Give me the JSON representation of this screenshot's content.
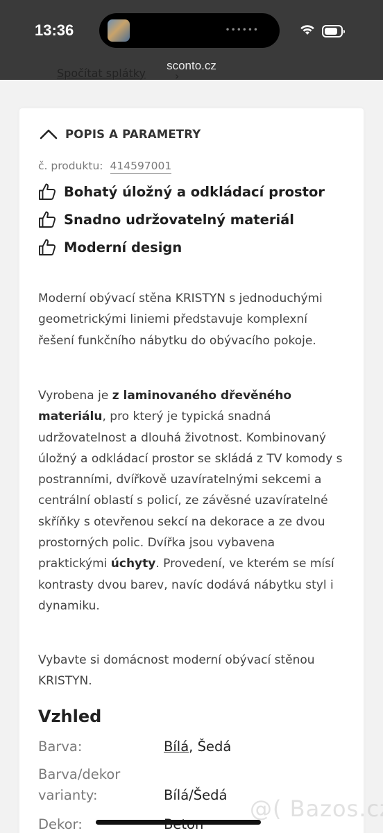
{
  "status_bar": {
    "time": "13:36",
    "url": "sconto.cz",
    "battery_level": 0.8,
    "dots": "••••••"
  },
  "cut_link": {
    "text": "Spočítat splátky",
    "chevron": "›"
  },
  "section": {
    "title": "POPIS A PARAMETRY",
    "product_label": "č. produktu:",
    "product_number": "414597001"
  },
  "features": [
    {
      "icon": "thumbs-up-icon",
      "text": "Bohatý úložný a odkládací prostor"
    },
    {
      "icon": "thumbs-up-icon",
      "text": "Snadno udržovatelný materiál"
    },
    {
      "icon": "thumbs-up-icon",
      "text": "Moderní design"
    }
  ],
  "description": {
    "p1": "Moderní obývací stěna KRISTYN s jednoduchými geometrickými liniemi představuje komplexní řešení funkčního nábytku do obývacího pokoje.",
    "p2_a": "Vyrobena je ",
    "p2_b": "z laminovaného dřevěného materiálu",
    "p2_c": ", pro který je typická snadná udržovatelnost a dlouhá životnost. Kombinovaný úložný a odkládací prostor se skládá z TV komody s postranními, dvířkově uzavíratelnými sekcemi a centrální oblastí s policí, ze závěsné uzavíratelné skříňky s otevřenou sekcí na dekorace a ze dvou prostorných polic. Dvířka jsou vybavena praktickými ",
    "p2_d": "úchyty",
    "p2_e": ". Provedení, ve kterém se mísí kontrasty dvou barev, navíc dodává nábytku styl i dynamiku.",
    "p3": "Vybavte si domácnost moderní obývací stěnou KRISTYN."
  },
  "specs": {
    "heading": "Vzhled",
    "rows": [
      {
        "label": "Barva:",
        "value_link": "Bílá",
        "value_rest": ", Šedá"
      },
      {
        "label_line1": "Barva/dekor",
        "label_line2": "varianty:",
        "value": "Bílá/Šedá"
      },
      {
        "label": "Dekor:",
        "value": "Beton"
      }
    ]
  },
  "watermark": "@( Bazos.cz"
}
